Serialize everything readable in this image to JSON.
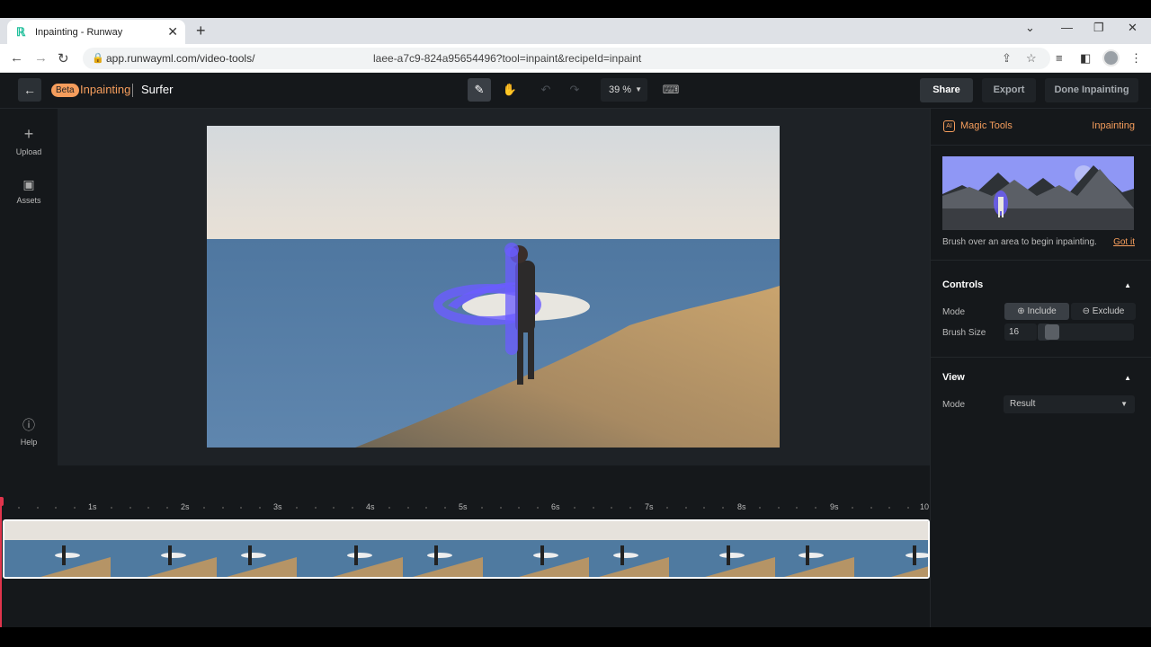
{
  "browser": {
    "tab_title": "Inpainting - Runway",
    "url_left": "app.runwayml.com/video-tools/",
    "url_right": "laee-a7c9-824a95654496?tool=inpaint&recipeId=inpaint",
    "icons": [
      "back-arrow-icon",
      "forward-arrow-icon",
      "reload-icon",
      "lock-icon",
      "share-icon",
      "star-icon",
      "media-icon",
      "sidebar-icon",
      "profile-icon",
      "menu-icon"
    ]
  },
  "topbar": {
    "beta": "Beta",
    "title": "Inpainting",
    "project": "Surfer",
    "zoom": "39 %",
    "share": "Share",
    "export": "Export",
    "done": "Done Inpainting"
  },
  "leftbar": {
    "upload": "Upload",
    "assets": "Assets",
    "help": "Help"
  },
  "timeline": {
    "ticks": [
      "1s",
      "2s",
      "3s",
      "4s",
      "5s",
      "6s",
      "7s",
      "8s",
      "9s",
      "10"
    ]
  },
  "panel": {
    "ai_badge": "AI",
    "magic_tools": "Magic Tools",
    "inpainting": "Inpainting",
    "hint": "Brush over an area to begin inpainting.",
    "got_it": "Got it",
    "controls": "Controls",
    "mode_label": "Mode",
    "include": "Include",
    "exclude": "Exclude",
    "brush_size_label": "Brush Size",
    "brush_size_value": "16",
    "view": "View",
    "view_mode_label": "Mode",
    "view_mode_value": "Result"
  },
  "colors": {
    "accent": "#f59d5c",
    "mask": "#6b5cff"
  }
}
